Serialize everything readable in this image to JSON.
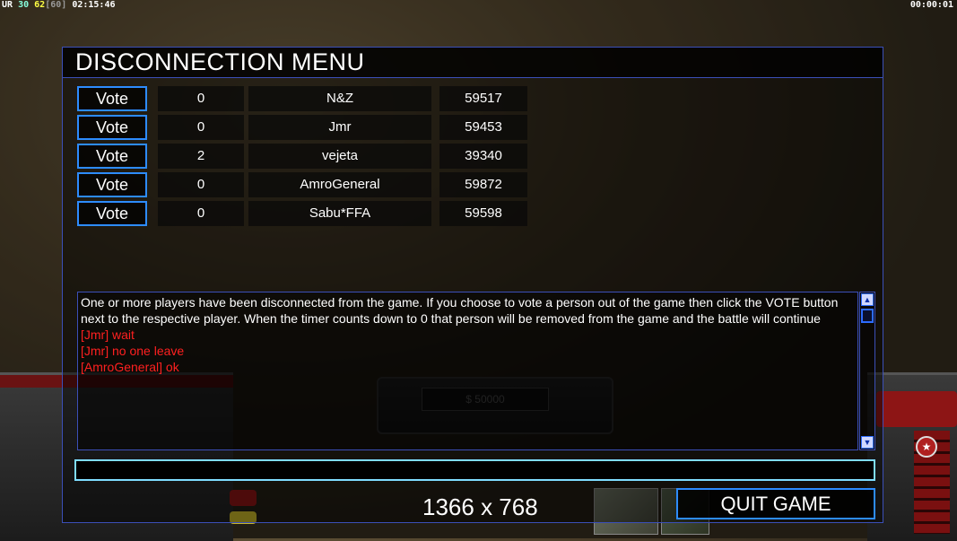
{
  "hud": {
    "top_left_prefix": "UR",
    "top_left_a": "30",
    "top_left_b": "62",
    "top_left_c": "[60]",
    "top_left_time": "02:15:46",
    "top_right_time": "00:00:01",
    "money": "$ 50000"
  },
  "dialog": {
    "title": "DISCONNECTION MENU",
    "vote_label": "Vote",
    "players": [
      {
        "votes": "0",
        "name": "N&Z",
        "ping": "59517"
      },
      {
        "votes": "0",
        "name": "Jmr",
        "ping": "59453"
      },
      {
        "votes": "2",
        "name": "vejeta",
        "ping": "39340"
      },
      {
        "votes": "0",
        "name": "AmroGeneral",
        "ping": "59872"
      },
      {
        "votes": "0",
        "name": "Sabu*FFA",
        "ping": "59598"
      }
    ],
    "chat": {
      "system_message": "One or more players have been disconnected from the game. If you choose to vote a person out of the game then click the VOTE button next to the respective player. When the timer counts down to 0 that person will be removed from the game and the battle will continue",
      "messages": [
        "[Jmr] wait",
        "[Jmr] no one leave",
        "[AmroGeneral] ok"
      ]
    },
    "chat_input_value": "",
    "resolution_text": "1366 x 768",
    "quit_label": "QUIT GAME"
  }
}
